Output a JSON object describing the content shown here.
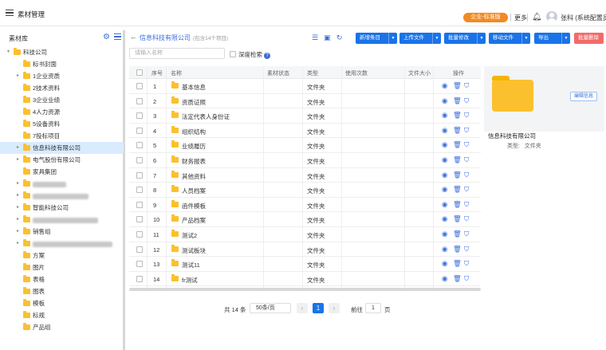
{
  "app": {
    "title": "素材管理",
    "edition": "企业-标准版",
    "more": "更多",
    "user": "张科 (系统配置员)"
  },
  "sidebar": {
    "title": "素材库",
    "tree": [
      {
        "label": "科技公司",
        "level": 0,
        "arrow": "▾"
      },
      {
        "label": "标书封面",
        "level": 1,
        "arrow": ""
      },
      {
        "label": "1企业资质",
        "level": 1,
        "arrow": "▸"
      },
      {
        "label": "2技术资料",
        "level": 1,
        "arrow": ""
      },
      {
        "label": "3企业业绩",
        "level": 1,
        "arrow": ""
      },
      {
        "label": "4人力资源",
        "level": 1,
        "arrow": ""
      },
      {
        "label": "5设备资料",
        "level": 1,
        "arrow": ""
      },
      {
        "label": "7投标项目",
        "level": 1,
        "arrow": ""
      },
      {
        "label": "信息科技有限公司",
        "level": 1,
        "arrow": "▸",
        "selected": true
      },
      {
        "label": "电气股份有限公司",
        "level": 1,
        "arrow": "▸"
      },
      {
        "label": "家具集团",
        "level": 1,
        "arrow": ""
      },
      {
        "label": "",
        "level": 1,
        "arrow": "▸",
        "blur": 42
      },
      {
        "label": "",
        "level": 1,
        "arrow": "▸",
        "blur": 70
      },
      {
        "label": "智能科技公司",
        "level": 1,
        "arrow": "▸"
      },
      {
        "label": "",
        "level": 1,
        "arrow": "▸",
        "blur": 82
      },
      {
        "label": "销售组",
        "level": 1,
        "arrow": "▸"
      },
      {
        "label": "",
        "level": 1,
        "arrow": "▸",
        "blur": 100
      },
      {
        "label": "方案",
        "level": 1,
        "arrow": ""
      },
      {
        "label": "图片",
        "level": 1,
        "arrow": ""
      },
      {
        "label": "表格",
        "level": 1,
        "arrow": ""
      },
      {
        "label": "图表",
        "level": 1,
        "arrow": ""
      },
      {
        "label": "模板",
        "level": 1,
        "arrow": ""
      },
      {
        "label": "标规",
        "level": 1,
        "arrow": ""
      },
      {
        "label": "产品组",
        "level": 1,
        "arrow": ""
      }
    ]
  },
  "content": {
    "breadcrumb": "信息科技有限公司",
    "count": "(包含14个项目)",
    "buttons": [
      {
        "label": "新增条目",
        "dropdown": true
      },
      {
        "label": "上传文件",
        "dropdown": true
      },
      {
        "label": "批量修改",
        "dropdown": true
      },
      {
        "label": "移动文件",
        "dropdown": true
      },
      {
        "label": "导出",
        "dropdown": true
      },
      {
        "label": "批量删除",
        "dropdown": false,
        "danger": true
      }
    ],
    "search_placeholder": "请输入名称",
    "deep_search": "深度检索",
    "columns": [
      "序号",
      "名称",
      "素材状态",
      "类型",
      "使用次数",
      "文件大小",
      "操作"
    ],
    "rows": [
      {
        "no": "1",
        "name": "基本信息",
        "type": "文件夹"
      },
      {
        "no": "2",
        "name": "资质证照",
        "type": "文件夹"
      },
      {
        "no": "3",
        "name": "法定代表人身份证",
        "type": "文件夹"
      },
      {
        "no": "4",
        "name": "组织结构",
        "type": "文件夹"
      },
      {
        "no": "5",
        "name": "业绩履历",
        "type": "文件夹"
      },
      {
        "no": "6",
        "name": "财务报表",
        "type": "文件夹"
      },
      {
        "no": "7",
        "name": "其他资料",
        "type": "文件夹"
      },
      {
        "no": "8",
        "name": "人员档案",
        "type": "文件夹"
      },
      {
        "no": "9",
        "name": "函件模板",
        "type": "文件夹"
      },
      {
        "no": "10",
        "name": "产品档案",
        "type": "文件夹"
      },
      {
        "no": "11",
        "name": "测试2",
        "type": "文件夹"
      },
      {
        "no": "12",
        "name": "测试板块",
        "type": "文件夹"
      },
      {
        "no": "13",
        "name": "测试11",
        "type": "文件夹"
      },
      {
        "no": "14",
        "name": "fr测试",
        "type": "文件夹"
      }
    ],
    "pager": {
      "total": "共 14 条",
      "page_size": "50条/页",
      "current": "1",
      "goto": "前往",
      "goto_value": "1",
      "page_word": "页"
    }
  },
  "detail": {
    "edit": "编辑信息",
    "name": "信息科技有限公司",
    "type_label": "类型:",
    "type_value": "文件夹"
  }
}
